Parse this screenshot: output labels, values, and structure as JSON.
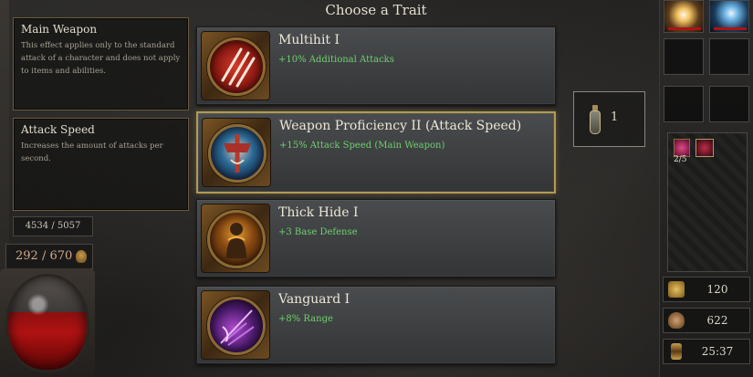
{
  "title": "Choose a Trait",
  "info_boxes": [
    {
      "title": "Main Weapon",
      "description": "This effect applies only to the standard attack of a character and does not apply to items and abilities."
    },
    {
      "title": "Attack Speed",
      "description": "Increases the amount of attacks per second."
    }
  ],
  "stats": {
    "experience": "4534 / 5057",
    "health": "292 / 670"
  },
  "traits": [
    {
      "name": "Multihit I",
      "effect": "+10% Additional Attacks",
      "icon": "claw-slash-icon",
      "selected": false
    },
    {
      "name": "Weapon Proficiency II (Attack Speed)",
      "effect": "+15% Attack Speed  (Main Weapon)",
      "icon": "weapon-proficiency-icon",
      "selected": true
    },
    {
      "name": "Thick Hide I",
      "effect": "+3 Base Defense",
      "icon": "thick-hide-icon",
      "selected": false
    },
    {
      "name": "Vanguard I",
      "effect": "+8% Range",
      "icon": "vanguard-icon",
      "selected": false
    }
  ],
  "potion": {
    "count": "1",
    "icon": "potion-bottle-icon"
  },
  "buffs": {
    "counter": "2/5"
  },
  "resources": {
    "gold": "120",
    "souls": "622",
    "time": "25:37"
  },
  "colors": {
    "effect_text": "#6fd06e",
    "selected_border": "#b39a52",
    "health_orb": "#b01212"
  }
}
